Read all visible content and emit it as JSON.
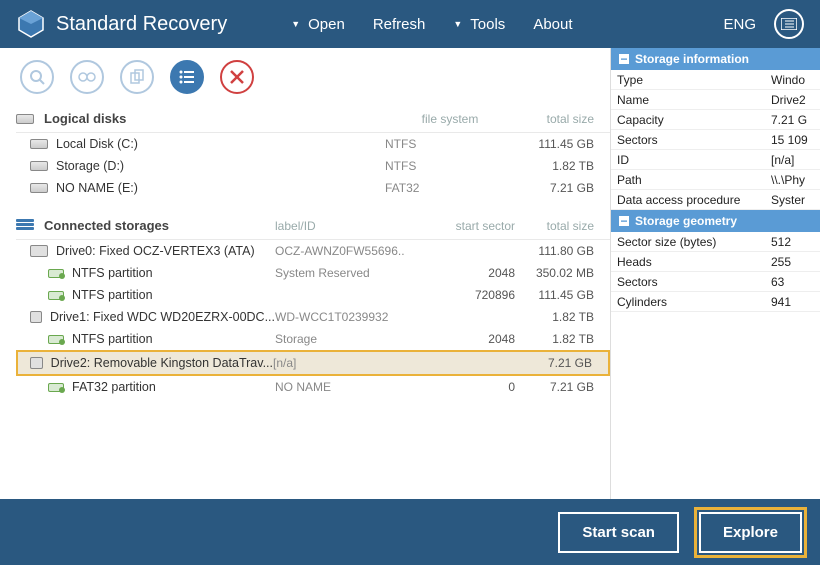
{
  "app": {
    "title": "Standard Recovery"
  },
  "lang": "ENG",
  "menu": {
    "open": "Open",
    "refresh": "Refresh",
    "tools": "Tools",
    "about": "About"
  },
  "sections": {
    "logical": {
      "title": "Logical disks",
      "col_fs": "file system",
      "col_size": "total size"
    },
    "connected": {
      "title": "Connected storages",
      "col_label": "label/ID",
      "col_start": "start sector",
      "col_size": "total size"
    }
  },
  "logical_disks": [
    {
      "name": "Local Disk (C:)",
      "fs": "NTFS",
      "size": "111.45 GB"
    },
    {
      "name": "Storage (D:)",
      "fs": "NTFS",
      "size": "1.82 TB"
    },
    {
      "name": "NO NAME (E:)",
      "fs": "FAT32",
      "size": "7.21 GB"
    }
  ],
  "connected": [
    {
      "type": "drive",
      "name": "Drive0: Fixed OCZ-VERTEX3 (ATA)",
      "label": "OCZ-AWNZ0FW55696..",
      "start": "",
      "size": "111.80 GB"
    },
    {
      "type": "part",
      "name": "NTFS partition",
      "label": "System Reserved",
      "start": "2048",
      "size": "350.02 MB"
    },
    {
      "type": "part",
      "name": "NTFS partition",
      "label": "",
      "start": "720896",
      "size": "111.45 GB"
    },
    {
      "type": "drive",
      "name": "Drive1: Fixed WDC WD20EZRX-00DC...",
      "label": "WD-WCC1T0239932",
      "start": "",
      "size": "1.82 TB"
    },
    {
      "type": "part",
      "name": "NTFS partition",
      "label": "Storage",
      "start": "2048",
      "size": "1.82 TB"
    },
    {
      "type": "drive",
      "name": "Drive2: Removable Kingston DataTrav...",
      "label": "[n/a]",
      "start": "",
      "size": "7.21 GB",
      "selected": true
    },
    {
      "type": "part",
      "name": "FAT32 partition",
      "label": "NO NAME",
      "start": "0",
      "size": "7.21 GB"
    }
  ],
  "info": {
    "head1": "Storage information",
    "rows1": [
      {
        "k": "Type",
        "v": "Windo"
      },
      {
        "k": "Name",
        "v": "Drive2"
      },
      {
        "k": "Capacity",
        "v": "7.21 G"
      },
      {
        "k": "Sectors",
        "v": "15 109"
      },
      {
        "k": "ID",
        "v": "[n/a]"
      },
      {
        "k": "Path",
        "v": "\\\\.\\Phy"
      },
      {
        "k": "Data access procedure",
        "v": "Syster"
      }
    ],
    "head2": "Storage geometry",
    "rows2": [
      {
        "k": "Sector size (bytes)",
        "v": "512"
      },
      {
        "k": "Heads",
        "v": "255"
      },
      {
        "k": "Sectors",
        "v": "63"
      },
      {
        "k": "Cylinders",
        "v": "941"
      }
    ]
  },
  "footer": {
    "scan": "Start scan",
    "explore": "Explore"
  }
}
